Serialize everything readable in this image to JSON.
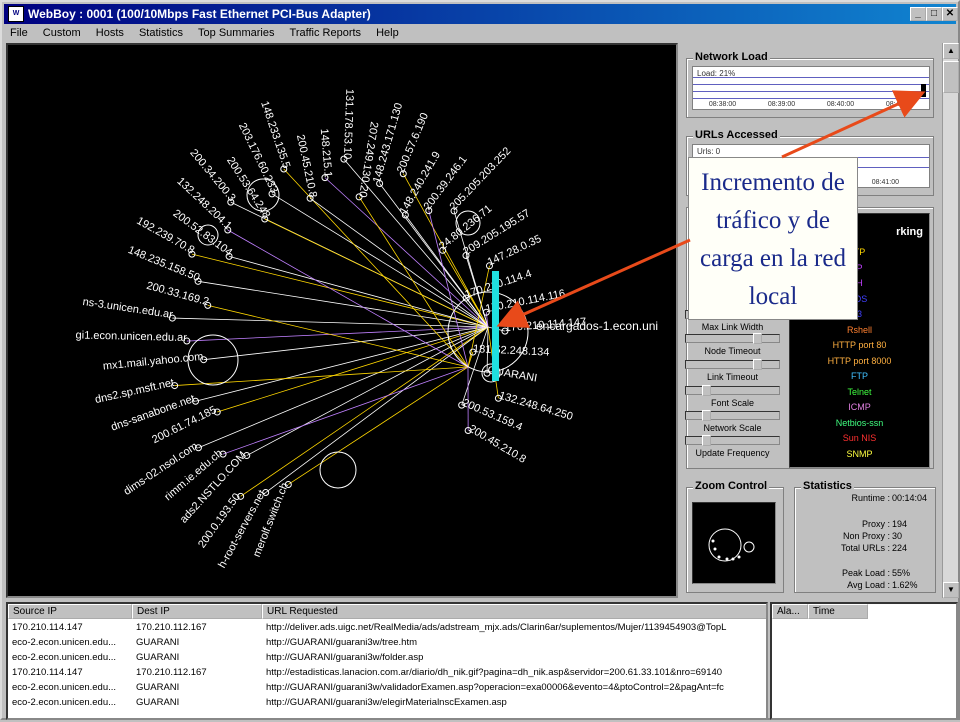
{
  "window": {
    "title": "WebBoy :  0001 (100/10Mbps Fast Ethernet PCI-Bus Adapter)",
    "icon_text": "W"
  },
  "menu": [
    "File",
    "Custom",
    "Hosts",
    "Statistics",
    "Top Summaries",
    "Traffic Reports",
    "Help"
  ],
  "graph": {
    "center_label": "encargados-1.econ.uni",
    "highlight_color": "#20e0e0",
    "hosts": [
      {
        "label": "merolf.switch.ch"
      },
      {
        "label": "h-root-servers.net"
      },
      {
        "label": "200.0.193.50"
      },
      {
        "label": "ads2.NSTLO.COM"
      },
      {
        "label": "rimm.ie.edu.ch"
      },
      {
        "label": "dims-02.nsol.com"
      },
      {
        "label": "200.61.74.185"
      },
      {
        "label": "dns-sanabone.net"
      },
      {
        "label": "dns2.sp.msft.net"
      },
      {
        "label": "mx1.mail.yahoo.com"
      },
      {
        "label": "gi1.econ.unicen.edu.ar"
      },
      {
        "label": "ns-3.unicen.edu.ar"
      },
      {
        "label": "200.33.169.2"
      },
      {
        "label": "148.235.158.50"
      },
      {
        "label": "192.239.70.8"
      },
      {
        "label": "200.52.83.104"
      },
      {
        "label": "132.248.204.1"
      },
      {
        "label": "200.34.200.3"
      },
      {
        "label": "200.53.64.248"
      },
      {
        "label": "203.176.60.233"
      },
      {
        "label": "148.233.135.5"
      },
      {
        "label": "200.45.210.8"
      },
      {
        "label": "148.215.1"
      },
      {
        "label": "131.178.53.10"
      },
      {
        "label": "207.249.130.20"
      },
      {
        "label": "148.243.171.130"
      },
      {
        "label": "200.57.6.190"
      },
      {
        "label": "148.240.241.9"
      },
      {
        "label": "200.39.246.1"
      },
      {
        "label": "205.205.203.252"
      },
      {
        "label": "24.80.236.71"
      },
      {
        "label": "209.205.195.57"
      },
      {
        "label": "147.28.0.35"
      },
      {
        "label": "170.210.114.4"
      },
      {
        "label": "170.210.114.116"
      },
      {
        "label": "170.210.114.147"
      },
      {
        "label": "181.52.248.134"
      },
      {
        "label": "GUARANI"
      },
      {
        "label": "132.248.64.250"
      },
      {
        "label": "200.53.159.4"
      },
      {
        "label": "200.45.210.8"
      }
    ]
  },
  "network_load": {
    "title": "Network Load",
    "readout": "Load: 21%",
    "times": [
      "08:38:00",
      "08:39:00",
      "08:40:00",
      "08:41:00"
    ],
    "level": 0.21
  },
  "urls_accessed": {
    "title": "URLs Accessed",
    "readout": "Urls: 0",
    "times": [
      "08:41:00"
    ]
  },
  "callout": {
    "text": "Incremento de tráfico y de carga en la red local"
  },
  "sliders": [
    {
      "label": "Max Link Width",
      "value": 0.35
    },
    {
      "label": "Node Timeout",
      "value": 0.8
    },
    {
      "label": "Link Timeout",
      "value": 0.8
    },
    {
      "label": "Font Scale",
      "value": 0.2
    },
    {
      "label": "Network Scale",
      "value": 0.2
    },
    {
      "label": "Update Frequency",
      "value": 0.2
    }
  ],
  "legend": {
    "title": "rking",
    "items": [
      {
        "label": "TP",
        "color": "#ffd700"
      },
      {
        "label": "P",
        "color": "#c040ff"
      },
      {
        "label": "H",
        "color": "#c040ff"
      },
      {
        "label": "IOS",
        "color": "#4040ff"
      },
      {
        "label": "3",
        "color": "#4040ff"
      },
      {
        "label": "Rshell",
        "color": "#ff8030"
      },
      {
        "label": "HTTP port 80",
        "color": "#ffb040"
      },
      {
        "label": "HTTP port 8000",
        "color": "#ffb040"
      },
      {
        "label": "FTP",
        "color": "#40c0ff"
      },
      {
        "label": "Telnet",
        "color": "#40ff40"
      },
      {
        "label": "ICMP",
        "color": "#e080e0"
      },
      {
        "label": "Netbios-ssn",
        "color": "#40ff80"
      },
      {
        "label": "Sun NIS",
        "color": "#ff3030"
      },
      {
        "label": "SNMP",
        "color": "#ffff40"
      }
    ]
  },
  "zoom": {
    "title": "Zoom Control"
  },
  "statistics": {
    "title": "Statistics",
    "rows": [
      {
        "key": "Runtime :",
        "value": "00:14:04"
      },
      {
        "key": "Proxy :",
        "value": "194"
      },
      {
        "key": "Non Proxy :",
        "value": "30"
      },
      {
        "key": "Total URLs :",
        "value": "224"
      },
      {
        "key": "Peak Load :",
        "value": "55%"
      },
      {
        "key": "Avg Load :",
        "value": "1.62%"
      }
    ]
  },
  "log": {
    "columns": [
      "Source IP",
      "Dest IP",
      "URL Requested"
    ],
    "rows": [
      [
        "170.210.114.147",
        "170.210.112.167",
        "http://deliver.ads.uigc.net/RealMedia/ads/adstream_mjx.ads/Clarin6ar/suplementos/Mujer/1139454903@TopL"
      ],
      [
        "eco-2.econ.unicen.edu...",
        "GUARANI",
        "http://GUARANI/guarani3w/tree.htm"
      ],
      [
        "eco-2.econ.unicen.edu...",
        "GUARANI",
        "http://GUARANI/guarani3w/folder.asp"
      ],
      [
        "170.210.114.147",
        "170.210.112.167",
        "http://estadisticas.lanacion.com.ar/diario/dh_nik.gif?pagina=dh_nik.asp&servidor=200.61.33.101&nro=69140"
      ],
      [
        "eco-2.econ.unicen.edu...",
        "GUARANI",
        "http://GUARANI/guarani3w/validadorExamen.asp?operacion=exa00006&evento=4&ptoControl=2&pagAnt=fc"
      ],
      [
        "eco-2.econ.unicen.edu...",
        "GUARANI",
        "http://GUARANI/guarani3w/elegirMaterialnscExamen.asp"
      ]
    ]
  },
  "alarms": {
    "columns": [
      "Ala...",
      "Time"
    ]
  }
}
